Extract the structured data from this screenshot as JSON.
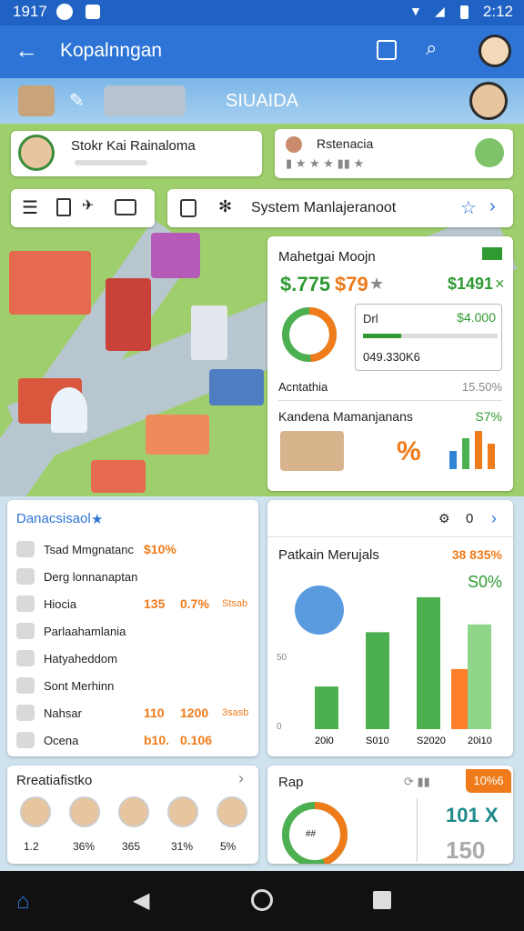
{
  "status": {
    "time": "1917",
    "clock": "2:12"
  },
  "appbar": {
    "title": "Kopalnngan"
  },
  "banner": {
    "title": "SIUAIDA"
  },
  "top_left_card": {
    "name": "Stokr Kai Rainaloma"
  },
  "top_right_card": {
    "name": "Rstenacia"
  },
  "toolbar": {
    "title": "System Manlajeranoot"
  },
  "stats_card": {
    "title": "Mahetgai Moojn",
    "v1": "$.775",
    "v2": "$79",
    "v3": "$1491",
    "box_label": "Drl",
    "box_value": "$4.000",
    "box_sub": "049.330K6",
    "row_label": "Acntathia",
    "row_value": "15.50%",
    "section_title": "Kandena Mamanjanans",
    "section_value": "S7%",
    "colors": {
      "green": "#2f9a32",
      "orange": "#ef7b1a",
      "blue": "#2f86d6"
    }
  },
  "list_card": {
    "title": "Danacsisaol",
    "star": "★",
    "items": [
      {
        "label": "Tsad Mmgnatanc",
        "value": "$10%",
        "amount": ""
      },
      {
        "label": "Derg lonnanaptan",
        "value": "",
        "amount": ""
      },
      {
        "label": "Hiocia",
        "value": "135",
        "extra": "0.7%",
        "amount": "Stsab"
      },
      {
        "label": "Parlaahamlania",
        "value": "",
        "amount": ""
      },
      {
        "label": "Hatyaheddom",
        "value": "",
        "amount": ""
      },
      {
        "label": "Sont Merhinn",
        "value": "",
        "amount": ""
      },
      {
        "label": "Nahsar",
        "value": "110",
        "extra": "1200",
        "amount": "3sasb"
      },
      {
        "label": "Ocena",
        "value": "b10.",
        "extra": "0.106",
        "amount": ""
      }
    ]
  },
  "chart_card": {
    "header_icon_text": "0",
    "title": "Patkain Merujals",
    "value_orange": "38 835%",
    "value_green": "S0%",
    "pill": "###",
    "chart_data": {
      "type": "bar",
      "categories": [
        "20i0",
        "S010",
        "S2020",
        "20i10"
      ],
      "series": [
        {
          "values": [
            22,
            50,
            68
          ]
        },
        {
          "values": [
            31,
            54
          ]
        }
      ],
      "bars": [
        {
          "x": "20i0",
          "value": 22,
          "color": "#4caf50"
        },
        {
          "x": "S010",
          "value": 50,
          "color": "#4caf50"
        },
        {
          "x": "S2020",
          "value": 68,
          "color": "#4caf50"
        },
        {
          "x": "S2020",
          "value": 31,
          "color": "#ff7f2a"
        },
        {
          "x": "20i10",
          "value": 54,
          "color": "#8fd58a"
        }
      ],
      "yticks": [
        "",
        "50",
        "0"
      ],
      "ylim": [
        0,
        75
      ]
    }
  },
  "bottom_left": {
    "title": "Rreatiafistko",
    "avatars": [
      {
        "label": "1.2"
      },
      {
        "label": "36%"
      },
      {
        "label": "365"
      },
      {
        "label": "31%"
      },
      {
        "label": "5%"
      }
    ]
  },
  "bottom_right": {
    "title": "Rap",
    "badge": "10%6",
    "big1": "101 X",
    "big2": "150",
    "small": "##"
  },
  "nav": [
    "home",
    "back",
    "recents-circle",
    "square"
  ]
}
